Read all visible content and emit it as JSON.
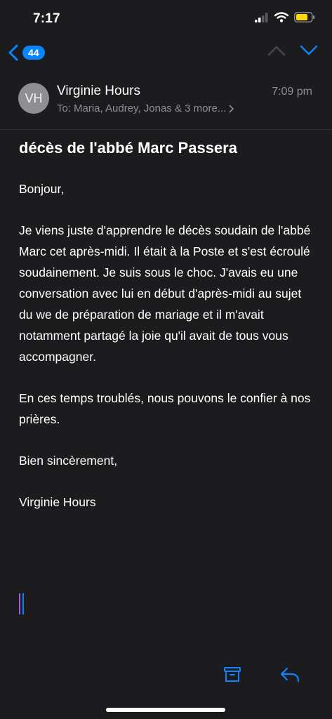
{
  "status": {
    "time": "7:17"
  },
  "nav": {
    "badge_count": "44"
  },
  "email": {
    "avatar_initials": "VH",
    "sender": "Virginie Hours",
    "time": "7:09 pm",
    "to_label": "To:",
    "recipients": "Maria, Audrey, Jonas & 3 more...",
    "subject": "décès de l'abbé Marc Passera",
    "body": [
      "Bonjour,",
      "Je viens juste d'apprendre le décès soudain de l'abbé Marc cet après-midi. Il était à la Poste et s'est écroulé soudainement. Je suis sous le choc. J'avais eu une conversation avec lui en début d'après-midi au sujet du we de préparation de mariage et il m'avait notamment partagé  la joie qu'il avait de tous vous accompagner.",
      "En ces temps troublés, nous pouvons le confier à nos prières.",
      "Bien sincèrement,",
      "Virginie Hours"
    ]
  },
  "colors": {
    "accent": "#0a84ff",
    "background": "#1c1c1e",
    "secondary_text": "#8e8e93"
  },
  "icons": [
    "signal-icon",
    "wifi-icon",
    "battery-icon",
    "chevron-left-icon",
    "chevron-up-icon",
    "chevron-down-icon",
    "archive-icon",
    "reply-icon"
  ]
}
